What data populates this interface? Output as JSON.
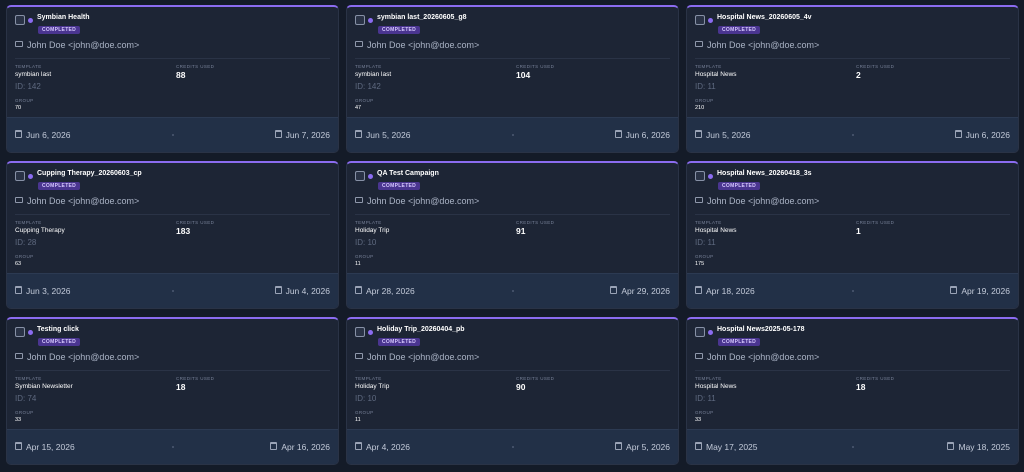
{
  "campaigns": [
    {
      "title": "Symbian Health",
      "status": "COMPLETED",
      "user": "John Doe <john@doe.com>",
      "template_label": "TEMPLATE",
      "template": "symbian last",
      "template_id": "ID: 142",
      "credits_label": "CREDITS USED",
      "credits": "88",
      "group_label": "GROUP",
      "group": "70",
      "start": "Jun 6, 2026",
      "end": "Jun 7, 2026"
    },
    {
      "title": "symbian last_20260605_g8",
      "status": "COMPLETED",
      "user": "John Doe <john@doe.com>",
      "template_label": "TEMPLATE",
      "template": "symbian last",
      "template_id": "ID: 142",
      "credits_label": "CREDITS USED",
      "credits": "104",
      "group_label": "GROUP",
      "group": "47",
      "start": "Jun 5, 2026",
      "end": "Jun 6, 2026"
    },
    {
      "title": "Hospital News_20260605_4v",
      "status": "COMPLETED",
      "user": "John Doe <john@doe.com>",
      "template_label": "TEMPLATE",
      "template": "Hospital News",
      "template_id": "ID: 11",
      "credits_label": "CREDITS USED",
      "credits": "2",
      "group_label": "GROUP",
      "group": "210",
      "start": "Jun 5, 2026",
      "end": "Jun 6, 2026"
    },
    {
      "title": "Cupping Therapy_20260603_cp",
      "status": "COMPLETED",
      "user": "John Doe <john@doe.com>",
      "template_label": "TEMPLATE",
      "template": "Cupping Therapy",
      "template_id": "ID: 28",
      "credits_label": "CREDITS USED",
      "credits": "183",
      "group_label": "GROUP",
      "group": "63",
      "start": "Jun 3, 2026",
      "end": "Jun 4, 2026"
    },
    {
      "title": "QA Test Campaign",
      "status": "COMPLETED",
      "user": "John Doe <john@doe.com>",
      "template_label": "TEMPLATE",
      "template": "Holiday Trip",
      "template_id": "ID: 10",
      "credits_label": "CREDITS USED",
      "credits": "91",
      "group_label": "GROUP",
      "group": "11",
      "start": "Apr 28, 2026",
      "end": "Apr 29, 2026"
    },
    {
      "title": "Hospital News_20260418_3s",
      "status": "COMPLETED",
      "user": "John Doe <john@doe.com>",
      "template_label": "TEMPLATE",
      "template": "Hospital News",
      "template_id": "ID: 11",
      "credits_label": "CREDITS USED",
      "credits": "1",
      "group_label": "GROUP",
      "group": "175",
      "start": "Apr 18, 2026",
      "end": "Apr 19, 2026"
    },
    {
      "title": "Testing click",
      "status": "COMPLETED",
      "user": "John Doe <john@doe.com>",
      "template_label": "TEMPLATE",
      "template": "Symbian Newsletter",
      "template_id": "ID: 74",
      "credits_label": "CREDITS USED",
      "credits": "18",
      "group_label": "GROUP",
      "group": "33",
      "start": "Apr 15, 2026",
      "end": "Apr 16, 2026"
    },
    {
      "title": "Holiday Trip_20260404_pb",
      "status": "COMPLETED",
      "user": "John Doe <john@doe.com>",
      "template_label": "TEMPLATE",
      "template": "Holiday Trip",
      "template_id": "ID: 10",
      "credits_label": "CREDITS USED",
      "credits": "90",
      "group_label": "GROUP",
      "group": "11",
      "start": "Apr 4, 2026",
      "end": "Apr 5, 2026"
    },
    {
      "title": "Hospital News2025-05-178",
      "status": "COMPLETED",
      "user": "John Doe <john@doe.com>",
      "template_label": "TEMPLATE",
      "template": "Hospital News",
      "template_id": "ID: 11",
      "credits_label": "CREDITS USED",
      "credits": "18",
      "group_label": "GROUP",
      "group": "33",
      "start": "May 17, 2025",
      "end": "May 18, 2025"
    }
  ],
  "colors": {
    "accent": "#8b6cf0",
    "badge_bg": "#4a3590",
    "card_bg": "#1d2535",
    "page_bg": "#141b28",
    "footer_bg": "#223047"
  },
  "icons": {
    "select": "checkbox",
    "status_dot": "dot-icon",
    "user": "mail-icon",
    "date": "calendar-icon"
  }
}
